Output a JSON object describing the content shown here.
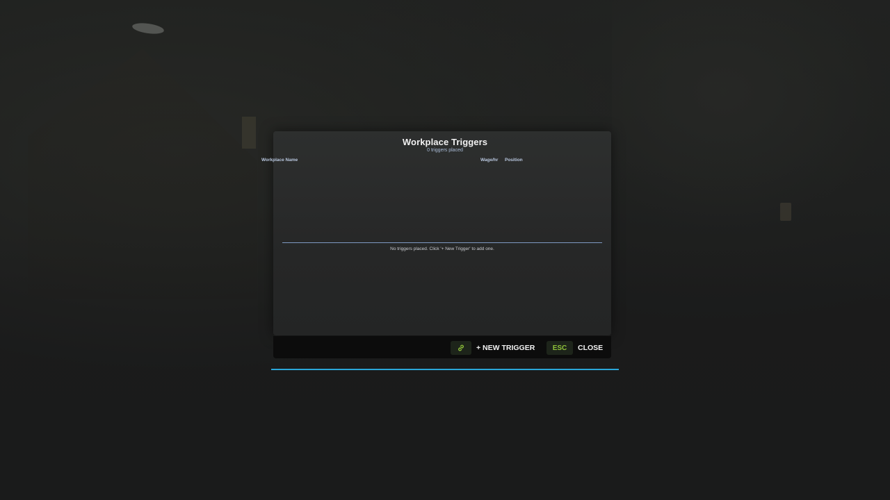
{
  "dialog": {
    "title": "Workplace Triggers",
    "subtitle": "0 triggers placed",
    "columns": {
      "name": "Workplace Name",
      "wage": "Wage/hr",
      "position": "Position"
    },
    "empty_message": "No triggers placed. Click '+ New Trigger' to add one."
  },
  "footer": {
    "new_trigger_key_icon": "link-icon",
    "new_trigger_label": "+ NEW TRIGGER",
    "close_key": "ESC",
    "close_label": "CLOSE"
  },
  "colors": {
    "accent_key": "#8fc13a",
    "divider": "#7f9ac4",
    "progress_line": "#2aa7d9"
  },
  "icons": [
    "link-icon"
  ]
}
